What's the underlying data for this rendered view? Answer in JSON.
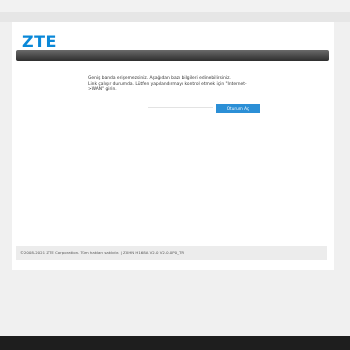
{
  "brand": {
    "logo": "ZTE",
    "color": "#0a88d8"
  },
  "message": {
    "line1": "Geniş banda erişemezsiniz. Aşağıdan bazı bilgileri edinebilirsiniz.",
    "line2": "Link çalışır durumda. Lütfen yapılandırmayı kontrol etmek için \"Internet->WAN\" girin."
  },
  "login": {
    "button_label": "Oturum Aç",
    "button_color": "#2b8fd6"
  },
  "footer": {
    "text": "©2008-2021 ZTE Corporation. Tüm hakları saklıdır.  |  ZXHN H168A V2.0 V2.0.0P0_TR"
  }
}
